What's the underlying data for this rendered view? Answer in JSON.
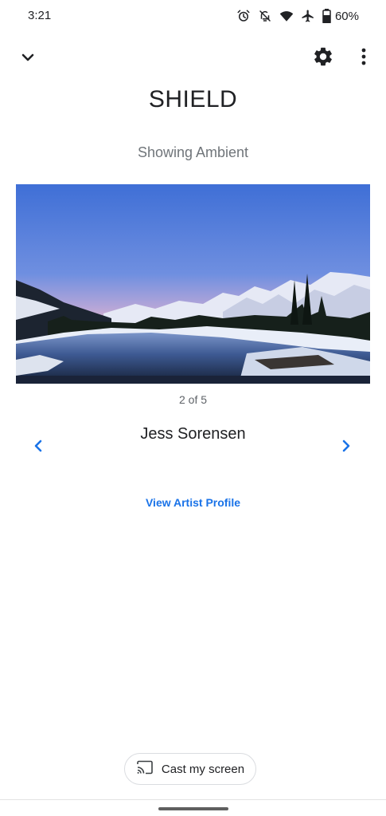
{
  "status_bar": {
    "time": "3:21",
    "battery_percent": "60%",
    "icons": [
      "alarm-icon",
      "bell-off-icon",
      "wifi-icon",
      "airplane-mode-icon",
      "battery-icon"
    ]
  },
  "app_bar": {
    "collapse_icon": "chevron-down-icon",
    "settings_icon": "gear-icon",
    "more_icon": "more-vert-icon"
  },
  "device": {
    "name": "SHIELD",
    "status": "Showing Ambient"
  },
  "photo": {
    "counter": "2 of 5",
    "artist": "Jess Sorensen",
    "prev_icon": "chevron-left-icon",
    "next_icon": "chevron-right-icon"
  },
  "links": {
    "view_artist_profile": "View Artist Profile"
  },
  "cast": {
    "label": "Cast my screen",
    "icon": "cast-icon"
  },
  "colors": {
    "accent": "#1a73e8",
    "text_primary": "#202124",
    "text_secondary": "#70757a"
  }
}
